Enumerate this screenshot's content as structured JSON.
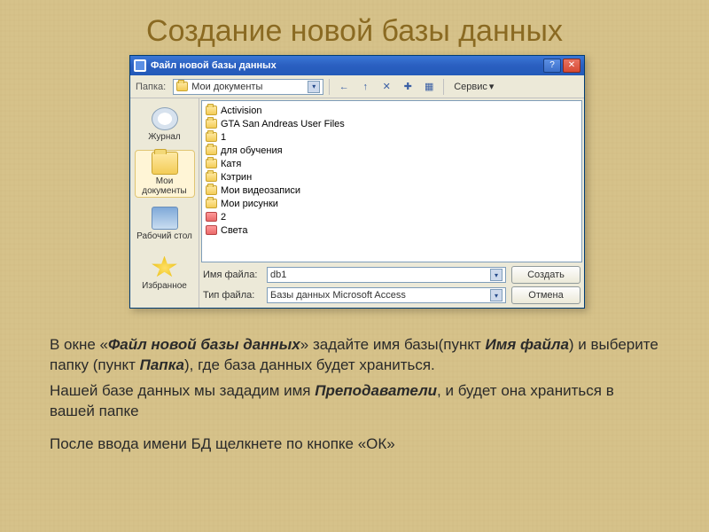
{
  "slide": {
    "title": "Создание новой базы данных"
  },
  "dialog": {
    "title": "Файл новой базы данных",
    "help_tip": "?",
    "close_tip": "✕",
    "toolbar": {
      "papka_label": "Папка:",
      "folder_selected": "Мои документы",
      "back_icon": "←",
      "up_icon": "↑",
      "delete_icon": "✕",
      "newfolder_icon": "✚",
      "views_icon": "▦",
      "tools_label": "Сервис",
      "tools_caret": "▾"
    },
    "places": [
      {
        "label": "Журнал",
        "kind": "clock"
      },
      {
        "label": "Мои документы",
        "kind": "folder",
        "selected": true
      },
      {
        "label": "Рабочий стол",
        "kind": "desk"
      },
      {
        "label": "Избранное",
        "kind": "star"
      }
    ],
    "listing": [
      {
        "name": "Activision",
        "kind": "fold"
      },
      {
        "name": "GTA San Andreas User Files",
        "kind": "fold"
      },
      {
        "name": "1",
        "kind": "fold"
      },
      {
        "name": "для обучения",
        "kind": "fold"
      },
      {
        "name": "Катя",
        "kind": "fold"
      },
      {
        "name": "Кэтрин",
        "kind": "fold"
      },
      {
        "name": "Мои видеозаписи",
        "kind": "fold"
      },
      {
        "name": "Мои рисунки",
        "kind": "fold"
      },
      {
        "name": "2",
        "kind": "db"
      },
      {
        "name": "Света",
        "kind": "db"
      }
    ],
    "filename_label": "Имя файла:",
    "filename_value": "db1",
    "filetype_label": "Тип файла:",
    "filetype_value": "Базы данных Microsoft Access",
    "create_label": "Создать",
    "cancel_label": "Отмена"
  },
  "text": {
    "p1_a": "В окне «",
    "p1_b": "Файл новой базы данных",
    "p1_c": "» задайте имя базы(пункт ",
    "p1_d": "Имя файла",
    "p1_e": ") и выберите папку (пункт ",
    "p1_f": "Папка",
    "p1_g": "), где база данных будет храниться.",
    "p2_a": "Нашей базе данных мы зададим имя ",
    "p2_b": "Преподаватели",
    "p2_c": ", и будет она храниться в вашей папке",
    "p3": "После ввода имени БД щелкнете по кнопке «ОК»"
  }
}
